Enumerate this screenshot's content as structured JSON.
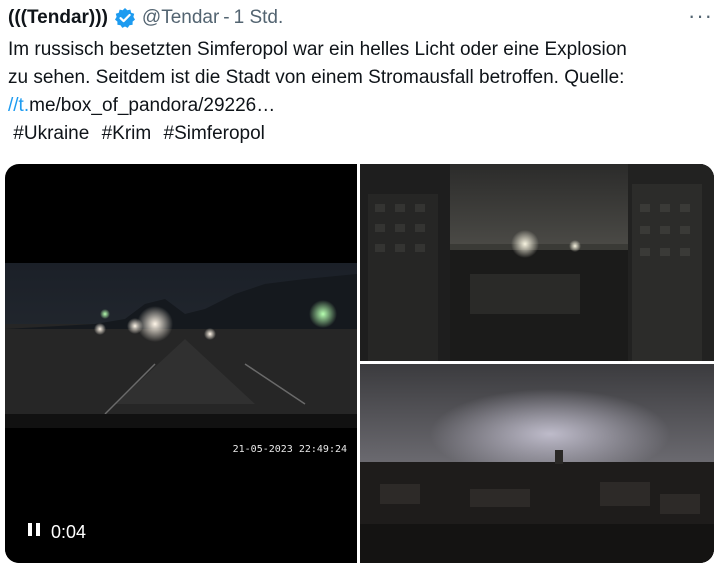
{
  "author": {
    "name": "(((Tendar)))",
    "handle": "@Tendar",
    "separator": "-",
    "time": "1 Std.",
    "verified_icon": "verified-badge-icon"
  },
  "tweet": {
    "text_line1": "Im russisch besetzten Simferopol war ein helles Licht oder eine Explosion",
    "text_line2": "zu sehen. Seitdem ist die Stadt von einem Stromausfall betroffen. Quelle:",
    "link_prefix": "//t.",
    "link_rest": "me/box_of_pandora/29226…",
    "hashtags": [
      "#Ukraine",
      "#Krim",
      "#Simferopol"
    ]
  },
  "media": {
    "video_timestamp": "21-05-2023 22:49:24",
    "video_time": "0:04",
    "pause_icon": "pause-icon"
  },
  "more_label": "···",
  "colors": {
    "accent": "#1d9bf0",
    "secondary_text": "#536471"
  }
}
